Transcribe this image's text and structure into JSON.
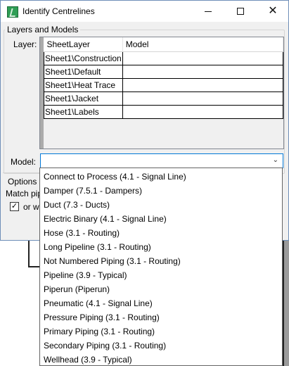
{
  "window": {
    "title": "Identify Centrelines",
    "minimize_symbol": "—",
    "maximize_symbol": "☐",
    "close_symbol": "✕"
  },
  "layers_group": {
    "title": "Layers and Models",
    "label": "Layer:",
    "columns": [
      "SheetLayer",
      "Model"
    ],
    "rows": [
      {
        "sheet_layer": "Sheet1\\Construction",
        "model": ""
      },
      {
        "sheet_layer": "Sheet1\\Default",
        "model": ""
      },
      {
        "sheet_layer": "Sheet1\\Heat Trace",
        "model": ""
      },
      {
        "sheet_layer": "Sheet1\\Jacket",
        "model": ""
      },
      {
        "sheet_layer": "Sheet1\\Labels",
        "model": ""
      }
    ]
  },
  "model_combo": {
    "label": "Model:",
    "value": "",
    "arrow": "⌄"
  },
  "options": {
    "title": "Options",
    "match_label": "Match pip",
    "checkbox_checked": true,
    "checkbox_symbol": "✓",
    "checkbox_label": "or w"
  },
  "dropdown_items": [
    "Connect to Process (4.1 - Signal Line)",
    "Damper (7.5.1 - Dampers)",
    "Duct (7.3 - Ducts)",
    "Electric Binary (4.1 - Signal Line)",
    "Hose (3.1 - Routing)",
    "Long Pipeline (3.1 - Routing)",
    "Not Numbered Piping (3.1 - Routing)",
    "Pipeline (3.9 - Typical)",
    "Piperun (Piperun)",
    "Pneumatic (4.1 - Signal Line)",
    "Pressure Piping (3.1 - Routing)",
    "Primary Piping (3.1 - Routing)",
    "Secondary Piping (3.1 - Routing)",
    "Wellhead (3.9 - Typical)"
  ]
}
